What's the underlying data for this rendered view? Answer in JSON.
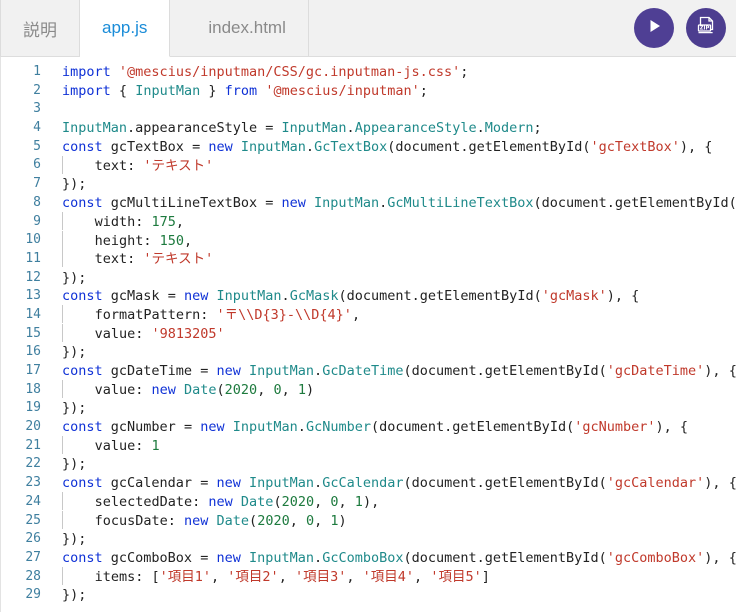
{
  "tabs": [
    {
      "label": "説明",
      "active": false,
      "name": "tab-description"
    },
    {
      "label": "app.js",
      "active": true,
      "name": "tab-app-js"
    },
    {
      "label": "index.html",
      "active": false,
      "name": "tab-index-html"
    }
  ],
  "toolbar": {
    "run_button_label": "",
    "run_icon": "play-icon",
    "zip_button_label": "",
    "zip_icon": "zip-download-icon",
    "zip_text": "ZIP"
  },
  "colors": {
    "accent_purple": "#4c3d8f",
    "active_tab_text": "#1a8cd8",
    "gutter_text": "#3f7f9f",
    "keyword": "#0f31d6",
    "class": "#1f8a8a",
    "string": "#c0392b",
    "number": "#1d7a3e",
    "tabbar_bg": "#f1f1f1"
  },
  "editor": {
    "language": "javascript",
    "filename": "app.js",
    "line_count": 29,
    "lines": [
      {
        "n": "1",
        "text": "import '@mescius/inputman/CSS/gc.inputman-js.css';"
      },
      {
        "n": "2",
        "text": "import { InputMan } from '@mescius/inputman';"
      },
      {
        "n": "3",
        "text": ""
      },
      {
        "n": "4",
        "text": "InputMan.appearanceStyle = InputMan.AppearanceStyle.Modern;"
      },
      {
        "n": "5",
        "text": "const gcTextBox = new InputMan.GcTextBox(document.getElementById('gcTextBox'), {"
      },
      {
        "n": "6",
        "text": "    text: 'テキスト'"
      },
      {
        "n": "7",
        "text": "});"
      },
      {
        "n": "8",
        "text": "const gcMultiLineTextBox = new InputMan.GcMultiLineTextBox(document.getElementById('gcM"
      },
      {
        "n": "9",
        "text": "    width: 175,"
      },
      {
        "n": "10",
        "text": "    height: 150,"
      },
      {
        "n": "11",
        "text": "    text: 'テキスト'"
      },
      {
        "n": "12",
        "text": "});"
      },
      {
        "n": "13",
        "text": "const gcMask = new InputMan.GcMask(document.getElementById('gcMask'), {"
      },
      {
        "n": "14",
        "text": "    formatPattern: '〒\\\\D{3}-\\\\D{4}',"
      },
      {
        "n": "15",
        "text": "    value: '9813205'"
      },
      {
        "n": "16",
        "text": "});"
      },
      {
        "n": "17",
        "text": "const gcDateTime = new InputMan.GcDateTime(document.getElementById('gcDateTime'), {"
      },
      {
        "n": "18",
        "text": "    value: new Date(2020, 0, 1)"
      },
      {
        "n": "19",
        "text": "});"
      },
      {
        "n": "20",
        "text": "const gcNumber = new InputMan.GcNumber(document.getElementById('gcNumber'), {"
      },
      {
        "n": "21",
        "text": "    value: 1"
      },
      {
        "n": "22",
        "text": "});"
      },
      {
        "n": "23",
        "text": "const gcCalendar = new InputMan.GcCalendar(document.getElementById('gcCalendar'), {"
      },
      {
        "n": "24",
        "text": "    selectedDate: new Date(2020, 0, 1),"
      },
      {
        "n": "25",
        "text": "    focusDate: new Date(2020, 0, 1)"
      },
      {
        "n": "26",
        "text": "});"
      },
      {
        "n": "27",
        "text": "const gcComboBox = new InputMan.GcComboBox(document.getElementById('gcComboBox'), {"
      },
      {
        "n": "28",
        "text": "    items: ['項目1', '項目2', '項目3', '項目4', '項目5']"
      },
      {
        "n": "29",
        "text": "});"
      }
    ]
  }
}
